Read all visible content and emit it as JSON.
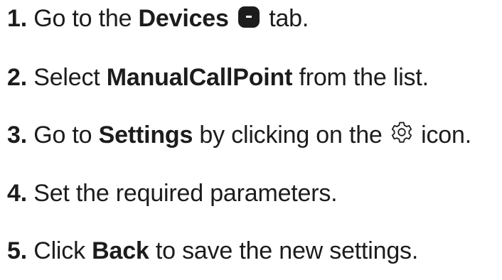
{
  "steps": [
    {
      "number": "1.",
      "parts": [
        "Go to the",
        "Devices",
        "tab."
      ],
      "icon": "devices-tab-icon"
    },
    {
      "number": "2.",
      "parts": [
        "Select",
        "ManualCallPoint",
        "from the list."
      ]
    },
    {
      "number": "3.",
      "parts": [
        "Go to",
        "Settings",
        "by clicking on the",
        "icon."
      ],
      "icon": "gear-icon"
    },
    {
      "number": "4.",
      "parts": [
        "Set the required parameters."
      ]
    },
    {
      "number": "5.",
      "parts": [
        "Click",
        "Back",
        "to save the new settings."
      ]
    }
  ],
  "colors": {
    "text": "#1c1c1c",
    "icon_fill": "#1c1c1c"
  }
}
